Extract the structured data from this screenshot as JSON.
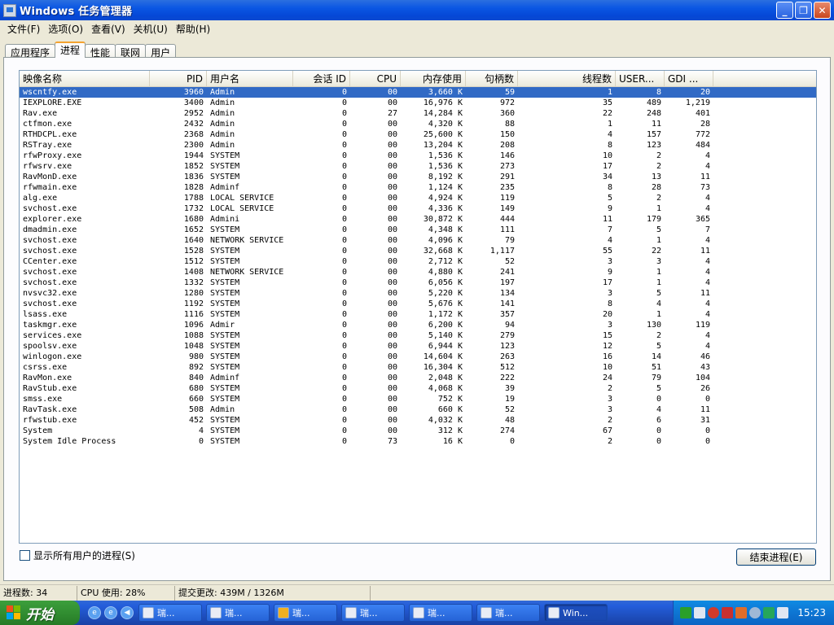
{
  "window": {
    "title": "Windows 任务管理器"
  },
  "menu": [
    "文件(F)",
    "选项(O)",
    "查看(V)",
    "关机(U)",
    "帮助(H)"
  ],
  "tabs": [
    "应用程序",
    "进程",
    "性能",
    "联网",
    "用户"
  ],
  "active_tab": 1,
  "columns": [
    "映像名称",
    "PID",
    "用户名",
    "会话 ID",
    "CPU",
    "内存使用",
    "句柄数",
    "线程数",
    "USER...",
    "GDI ..."
  ],
  "rows": [
    [
      "wscntfy.exe",
      "3960",
      "Admin",
      "0",
      "00",
      "3,660 K",
      "59",
      "1",
      "8",
      "20"
    ],
    [
      "IEXPLORE.EXE",
      "3400",
      "Admin",
      "0",
      "00",
      "16,976 K",
      "972",
      "35",
      "489",
      "1,219"
    ],
    [
      "Rav.exe",
      "2952",
      "Admin",
      "0",
      "27",
      "14,284 K",
      "360",
      "22",
      "248",
      "401"
    ],
    [
      "ctfmon.exe",
      "2432",
      "Admin",
      "0",
      "00",
      "4,320 K",
      "88",
      "1",
      "11",
      "28"
    ],
    [
      "RTHDCPL.exe",
      "2368",
      "Admin",
      "0",
      "00",
      "25,600 K",
      "150",
      "4",
      "157",
      "772"
    ],
    [
      "RSTray.exe",
      "2300",
      "Admin",
      "0",
      "00",
      "13,204 K",
      "208",
      "8",
      "123",
      "484"
    ],
    [
      "rfwProxy.exe",
      "1944",
      "SYSTEM",
      "0",
      "00",
      "1,536 K",
      "146",
      "10",
      "2",
      "4"
    ],
    [
      "rfwsrv.exe",
      "1852",
      "SYSTEM",
      "0",
      "00",
      "1,536 K",
      "273",
      "17",
      "2",
      "4"
    ],
    [
      "RavMonD.exe",
      "1836",
      "SYSTEM",
      "0",
      "00",
      "8,192 K",
      "291",
      "34",
      "13",
      "11"
    ],
    [
      "rfwmain.exe",
      "1828",
      "Adminf",
      "0",
      "00",
      "1,124 K",
      "235",
      "8",
      "28",
      "73"
    ],
    [
      "alg.exe",
      "1788",
      "LOCAL SERVICE",
      "0",
      "00",
      "4,924 K",
      "119",
      "5",
      "2",
      "4"
    ],
    [
      "svchost.exe",
      "1732",
      "LOCAL SERVICE",
      "0",
      "00",
      "4,336 K",
      "149",
      "9",
      "1",
      "4"
    ],
    [
      "explorer.exe",
      "1680",
      "Admini",
      "0",
      "00",
      "30,872 K",
      "444",
      "11",
      "179",
      "365"
    ],
    [
      "dmadmin.exe",
      "1652",
      "SYSTEM",
      "0",
      "00",
      "4,348 K",
      "111",
      "7",
      "5",
      "7"
    ],
    [
      "svchost.exe",
      "1640",
      "NETWORK SERVICE",
      "0",
      "00",
      "4,096 K",
      "79",
      "4",
      "1",
      "4"
    ],
    [
      "svchost.exe",
      "1528",
      "SYSTEM",
      "0",
      "00",
      "32,668 K",
      "1,117",
      "55",
      "22",
      "11"
    ],
    [
      "CCenter.exe",
      "1512",
      "SYSTEM",
      "0",
      "00",
      "2,712 K",
      "52",
      "3",
      "3",
      "4"
    ],
    [
      "svchost.exe",
      "1408",
      "NETWORK SERVICE",
      "0",
      "00",
      "4,880 K",
      "241",
      "9",
      "1",
      "4"
    ],
    [
      "svchost.exe",
      "1332",
      "SYSTEM",
      "0",
      "00",
      "6,056 K",
      "197",
      "17",
      "1",
      "4"
    ],
    [
      "nvsvc32.exe",
      "1280",
      "SYSTEM",
      "0",
      "00",
      "5,220 K",
      "134",
      "3",
      "5",
      "11"
    ],
    [
      "svchost.exe",
      "1192",
      "SYSTEM",
      "0",
      "00",
      "5,676 K",
      "141",
      "8",
      "4",
      "4"
    ],
    [
      "lsass.exe",
      "1116",
      "SYSTEM",
      "0",
      "00",
      "1,172 K",
      "357",
      "20",
      "1",
      "4"
    ],
    [
      "taskmgr.exe",
      "1096",
      "Admir",
      "0",
      "00",
      "6,200 K",
      "94",
      "3",
      "130",
      "119"
    ],
    [
      "services.exe",
      "1088",
      "SYSTEM",
      "0",
      "00",
      "5,140 K",
      "279",
      "15",
      "2",
      "4"
    ],
    [
      "spoolsv.exe",
      "1048",
      "SYSTEM",
      "0",
      "00",
      "6,944 K",
      "123",
      "12",
      "5",
      "4"
    ],
    [
      "winlogon.exe",
      "980",
      "SYSTEM",
      "0",
      "00",
      "14,604 K",
      "263",
      "16",
      "14",
      "46"
    ],
    [
      "csrss.exe",
      "892",
      "SYSTEM",
      "0",
      "00",
      "16,304 K",
      "512",
      "10",
      "51",
      "43"
    ],
    [
      "RavMon.exe",
      "840",
      "Adminf",
      "0",
      "00",
      "2,048 K",
      "222",
      "24",
      "79",
      "104"
    ],
    [
      "RavStub.exe",
      "680",
      "SYSTEM",
      "0",
      "00",
      "4,068 K",
      "39",
      "2",
      "5",
      "26"
    ],
    [
      "smss.exe",
      "660",
      "SYSTEM",
      "0",
      "00",
      "752 K",
      "19",
      "3",
      "0",
      "0"
    ],
    [
      "RavTask.exe",
      "508",
      "Admin",
      "0",
      "00",
      "660 K",
      "52",
      "3",
      "4",
      "11"
    ],
    [
      "rfwstub.exe",
      "452",
      "SYSTEM",
      "0",
      "00",
      "4,032 K",
      "48",
      "2",
      "6",
      "31"
    ],
    [
      "System",
      "4",
      "SYSTEM",
      "0",
      "00",
      "312 K",
      "274",
      "67",
      "0",
      "0"
    ],
    [
      "System Idle Process",
      "0",
      "SYSTEM",
      "0",
      "73",
      "16 K",
      "0",
      "2",
      "0",
      "0"
    ]
  ],
  "show_all_users_label": "显示所有用户的进程(S)",
  "end_process_label": "结束进程(E)",
  "status": {
    "processes": "进程数: 34",
    "cpu": "CPU 使用: 28%",
    "commit": "提交更改: 439M / 1326M"
  },
  "taskbar": {
    "start_label": "开始",
    "tasks": [
      "瑞...",
      "瑞...",
      "瑞...",
      "瑞...",
      "瑞...",
      "瑞...",
      "Win..."
    ],
    "clock": "15:23"
  },
  "colors": {
    "selection": "#316ac5",
    "titlebar": "#0a56e3",
    "taskbar": "#245edb",
    "start": "#3c9f3c"
  }
}
